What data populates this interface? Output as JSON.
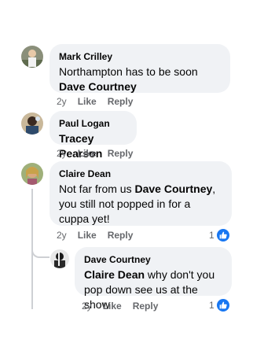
{
  "comments": [
    {
      "author": "Mark Crilley",
      "text": "Northampton has to be soon ",
      "mention": "Dave Courtney",
      "after": "",
      "age": "2y",
      "like": "Like",
      "reply": "Reply",
      "reactions": ""
    },
    {
      "author": "Paul Logan",
      "text": "",
      "mention": "Tracey Pearson",
      "after": "",
      "age": "2y",
      "like": "Like",
      "reply": "Reply",
      "reactions": ""
    },
    {
      "author": "Claire Dean",
      "text": "Not far from us ",
      "mention": "Dave Courtney",
      "after": ", you still not popped in for a cuppa yet!",
      "age": "2y",
      "like": "Like",
      "reply": "Reply",
      "reactions": "1"
    }
  ],
  "reply": {
    "author": "Dave Courtney",
    "mention": "Claire Dean",
    "text": " why don't you pop down see us at the show",
    "age": "2y",
    "like": "Like",
    "reply": "Reply",
    "reactions": "1"
  },
  "icons": {
    "like_badge": "thumbs-up-icon"
  },
  "colors": {
    "bubble": "#f0f2f5",
    "like_blue": "#1877f2",
    "meta": "#65676b"
  }
}
